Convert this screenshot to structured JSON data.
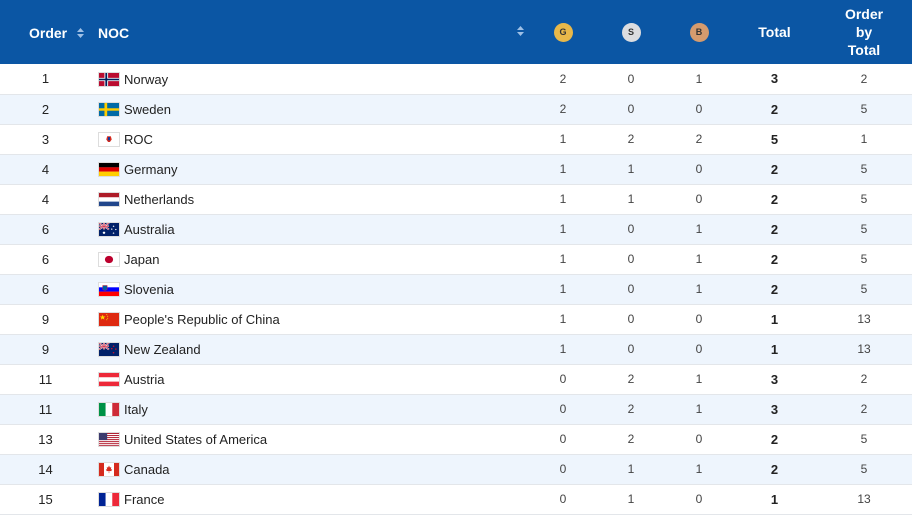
{
  "header": {
    "order": "Order",
    "noc": "NOC",
    "gold": "G",
    "silver": "S",
    "bronze": "B",
    "total": "Total",
    "order_by_total": [
      "Order",
      "by",
      "Total"
    ]
  },
  "rows": [
    {
      "order": "1",
      "country": "Norway",
      "flag": "norway",
      "gold": "2",
      "silver": "0",
      "bronze": "1",
      "total": "3",
      "by_total": "2"
    },
    {
      "order": "2",
      "country": "Sweden",
      "flag": "sweden",
      "gold": "2",
      "silver": "0",
      "bronze": "0",
      "total": "2",
      "by_total": "5"
    },
    {
      "order": "3",
      "country": "ROC",
      "flag": "roc",
      "gold": "1",
      "silver": "2",
      "bronze": "2",
      "total": "5",
      "by_total": "1"
    },
    {
      "order": "4",
      "country": "Germany",
      "flag": "germany",
      "gold": "1",
      "silver": "1",
      "bronze": "0",
      "total": "2",
      "by_total": "5"
    },
    {
      "order": "4",
      "country": "Netherlands",
      "flag": "netherlands",
      "gold": "1",
      "silver": "1",
      "bronze": "0",
      "total": "2",
      "by_total": "5"
    },
    {
      "order": "6",
      "country": "Australia",
      "flag": "australia",
      "gold": "1",
      "silver": "0",
      "bronze": "1",
      "total": "2",
      "by_total": "5"
    },
    {
      "order": "6",
      "country": "Japan",
      "flag": "japan",
      "gold": "1",
      "silver": "0",
      "bronze": "1",
      "total": "2",
      "by_total": "5"
    },
    {
      "order": "6",
      "country": "Slovenia",
      "flag": "slovenia",
      "gold": "1",
      "silver": "0",
      "bronze": "1",
      "total": "2",
      "by_total": "5"
    },
    {
      "order": "9",
      "country": "People's Republic of China",
      "flag": "china",
      "gold": "1",
      "silver": "0",
      "bronze": "0",
      "total": "1",
      "by_total": "13"
    },
    {
      "order": "9",
      "country": "New Zealand",
      "flag": "new-zealand",
      "gold": "1",
      "silver": "0",
      "bronze": "0",
      "total": "1",
      "by_total": "13"
    },
    {
      "order": "11",
      "country": "Austria",
      "flag": "austria",
      "gold": "0",
      "silver": "2",
      "bronze": "1",
      "total": "3",
      "by_total": "2"
    },
    {
      "order": "11",
      "country": "Italy",
      "flag": "italy",
      "gold": "0",
      "silver": "2",
      "bronze": "1",
      "total": "3",
      "by_total": "2"
    },
    {
      "order": "13",
      "country": "United States of America",
      "flag": "usa",
      "gold": "0",
      "silver": "2",
      "bronze": "0",
      "total": "2",
      "by_total": "5"
    },
    {
      "order": "14",
      "country": "Canada",
      "flag": "canada",
      "gold": "0",
      "silver": "1",
      "bronze": "1",
      "total": "2",
      "by_total": "5"
    },
    {
      "order": "15",
      "country": "France",
      "flag": "france",
      "gold": "0",
      "silver": "1",
      "bronze": "0",
      "total": "1",
      "by_total": "13"
    }
  ],
  "colors": {
    "header_bg": "#0b56a4",
    "row_alt": "#eef5fd",
    "gold": "#e8b84a",
    "silver": "#dcdde0",
    "bronze": "#d59b6e"
  },
  "icons": {
    "sort": "sort-updown-icon"
  }
}
